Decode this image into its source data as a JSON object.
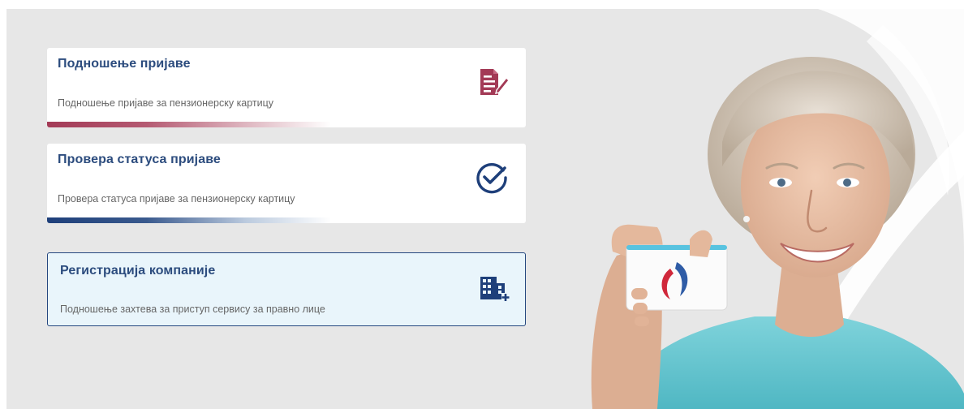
{
  "cards": [
    {
      "title": "Подношење пријаве",
      "description": "Подношење пријаве за пензионерску картицу",
      "icon": "document-edit-icon",
      "accent": "#a33a56"
    },
    {
      "title": "Провера статуса пријаве",
      "description": "Провера статуса пријаве за пензионерску картицу",
      "icon": "check-circle-icon",
      "accent": "#1e3f7a"
    },
    {
      "title": "Регистрација компаније",
      "description": "Подношење захтева за приступ сервису за правно лице",
      "icon": "building-add-icon",
      "accent": "#25477f"
    }
  ],
  "hero": {
    "image": "senior-woman-holding-card-photo"
  },
  "colors": {
    "panel_background": "#e7e7e7",
    "title_text": "#2c4c7e",
    "description_text": "#666666",
    "active_card_background": "#e9f5fb"
  }
}
